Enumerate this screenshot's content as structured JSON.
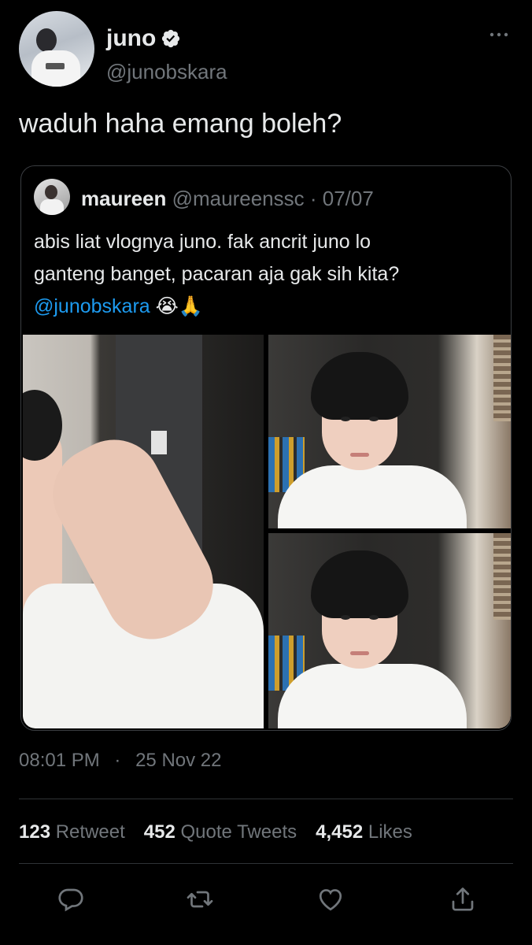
{
  "author": {
    "display_name": "juno",
    "handle": "@junobskara",
    "verified": true,
    "avatar": "profile-photo"
  },
  "tweet": {
    "text": "waduh haha emang boleh?"
  },
  "quoted": {
    "display_name": "maureen",
    "handle": "@maureenssc",
    "separator": " · ",
    "date": "07/07",
    "text_lines": [
      "abis liat vlognya juno. fak ancrit juno lo",
      "ganteng banget, pacaran aja gak sih kita?"
    ],
    "mention": "@junobskara",
    "emoji": "😭🙏",
    "media": [
      "photo-man-touching-hair",
      "photo-man-smiling-top",
      "photo-man-smiling-bottom"
    ]
  },
  "meta": {
    "time": "08:01 PM",
    "dot": "·",
    "date": "25 Nov 22"
  },
  "stats": {
    "retweets": "123",
    "retweets_label": "Retweet",
    "quotes": "452",
    "quotes_label": "Quote Tweets",
    "likes": "4,452",
    "likes_label": "Likes"
  },
  "icons": {
    "verified": "verified-badge-icon",
    "more": "more-horizontal-icon",
    "reply": "reply-icon",
    "retweet": "retweet-icon",
    "like": "heart-icon",
    "share": "share-icon"
  },
  "colors": {
    "background": "#000000",
    "text": "#e7e9ea",
    "muted": "#71767b",
    "link": "#1d9bf0",
    "border": "#2f3336"
  }
}
